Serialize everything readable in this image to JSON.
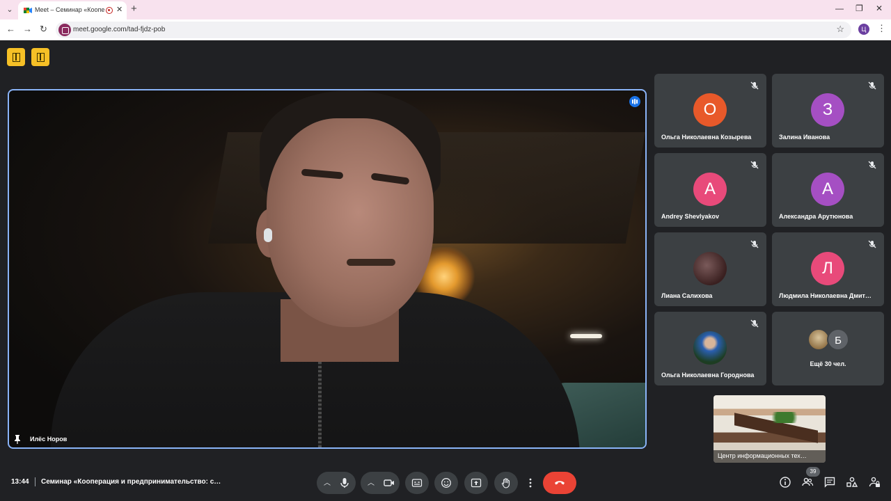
{
  "browser": {
    "tab_title": "Meet – Семинар «Коопер",
    "url": "meet.google.com/tad-fjdz-pob",
    "profile_initial": "Ц"
  },
  "main_video": {
    "speaker_name": "Илёс Норов"
  },
  "participants": [
    {
      "initial": "О",
      "name": "Ольга Николаевна Козырева",
      "color": "#e8592a"
    },
    {
      "initial": "З",
      "name": "Залина Иванова",
      "color": "#a54fc3"
    },
    {
      "initial": "A",
      "name": "Andrey Shevlyakov",
      "color": "#e84a7a"
    },
    {
      "initial": "А",
      "name": "Александра Арутюнова",
      "color": "#a54fc3"
    },
    {
      "initial": "",
      "name": "Лиана Салихова",
      "color": ""
    },
    {
      "initial": "Л",
      "name": "Людмила Николаевна Дмит…",
      "color": "#e84a7a"
    },
    {
      "initial": "",
      "name": "Ольга Николаевна Городнова",
      "color": ""
    }
  ],
  "more_tile": {
    "initial": "Б",
    "label": "Ещё 30 чел."
  },
  "self_view": {
    "label": "Центр информационных тех…"
  },
  "bottom": {
    "time": "13:44",
    "meeting_title": "Семинар «Кооперация и предпринимательство: с…",
    "participant_count": "39"
  }
}
